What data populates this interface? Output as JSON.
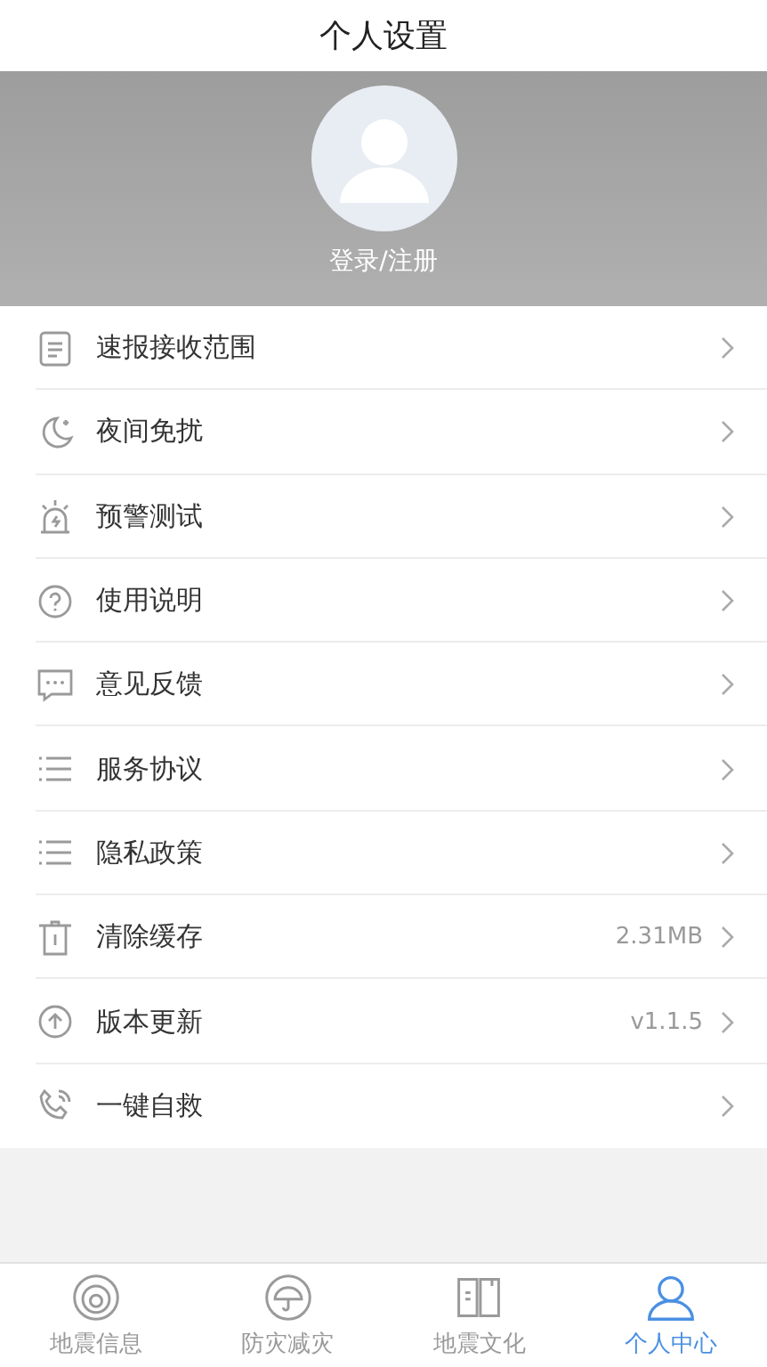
{
  "header": {
    "title": "个人设置"
  },
  "profile": {
    "login_label": "登录/注册"
  },
  "menu": [
    {
      "label": "速报接收范围"
    },
    {
      "label": "夜间免扰"
    },
    {
      "label": "预警测试"
    },
    {
      "label": "使用说明"
    },
    {
      "label": "意见反馈"
    },
    {
      "label": "服务协议"
    },
    {
      "label": "隐私政策"
    },
    {
      "label": "清除缓存",
      "value": "2.31MB"
    },
    {
      "label": "版本更新",
      "value": "v1.1.5"
    },
    {
      "label": "一键自救"
    }
  ],
  "tabs": [
    {
      "label": "地震信息",
      "selected": false
    },
    {
      "label": "防灾减灾",
      "selected": false
    },
    {
      "label": "地震文化",
      "selected": false
    },
    {
      "label": "个人中心",
      "selected": true
    }
  ]
}
